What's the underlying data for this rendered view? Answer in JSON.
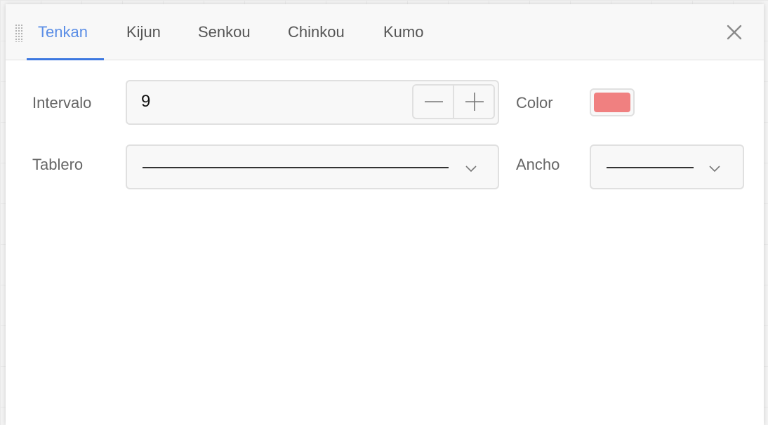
{
  "tabs": [
    {
      "label": "Tenkan",
      "active": true
    },
    {
      "label": "Kijun",
      "active": false
    },
    {
      "label": "Senkou",
      "active": false
    },
    {
      "label": "Chinkou",
      "active": false
    },
    {
      "label": "Kumo",
      "active": false
    }
  ],
  "icons": {
    "drag": "drag-handle-icon",
    "close": "close-icon",
    "minus": "minus-icon",
    "plus": "plus-icon",
    "chevron": "chevron-down-icon"
  },
  "form": {
    "interval_label": "Intervalo",
    "interval_value": "9",
    "color_label": "Color",
    "color_value": "#f08080",
    "board_label": "Tablero",
    "board_selected": "solid-line",
    "width_label": "Ancho",
    "width_selected": "thin-line"
  },
  "colors": {
    "accent": "#3d78e0",
    "active_tab_text": "#5b8ee6",
    "swatch": "#f08080"
  }
}
